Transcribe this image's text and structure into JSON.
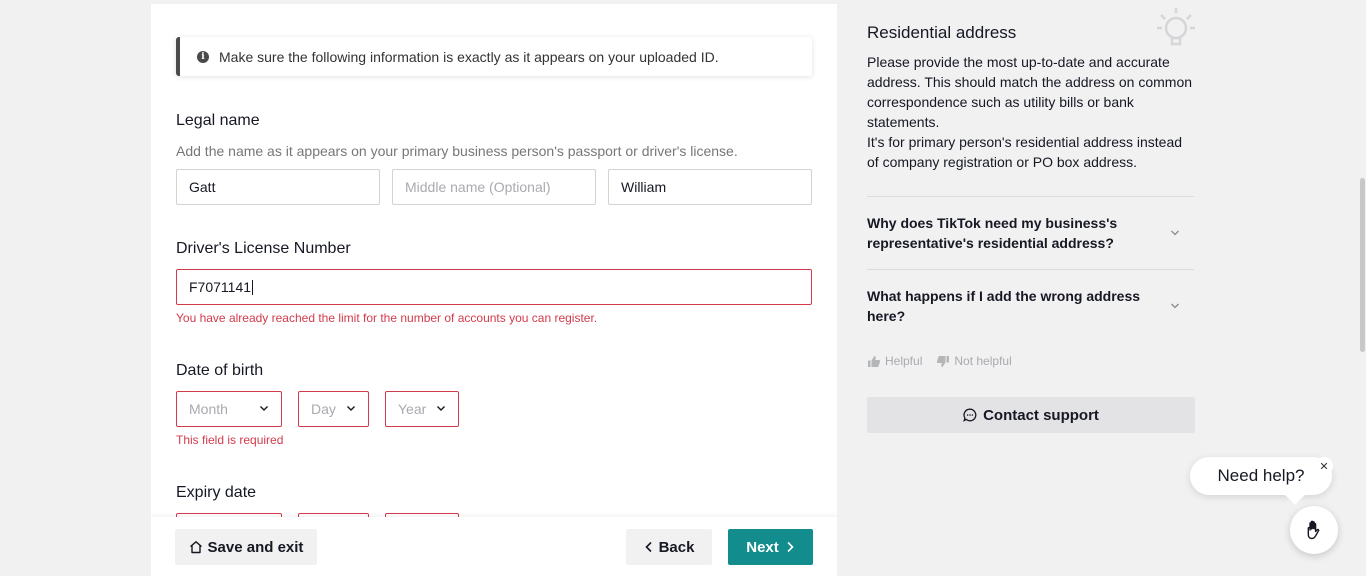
{
  "notice": {
    "text": "Make sure the following information is exactly as it appears on your uploaded ID."
  },
  "legal_name": {
    "label": "Legal name",
    "description": "Add the name as it appears on your primary business person's passport or driver's license.",
    "first_value": "Gatt",
    "middle_placeholder": "Middle name (Optional)",
    "last_value": "William"
  },
  "license": {
    "label": "Driver's License Number",
    "value": "F7071141",
    "error": "You have already reached the limit for the number of accounts you can register."
  },
  "dob": {
    "label": "Date of birth",
    "month_placeholder": "Month",
    "day_placeholder": "Day",
    "year_placeholder": "Year",
    "error": "This field is required"
  },
  "expiry": {
    "label": "Expiry date"
  },
  "footer": {
    "save_label": "Save and exit",
    "back_label": "Back",
    "next_label": "Next"
  },
  "sidebar": {
    "title": "Residential address",
    "paragraph1": "Please provide the most up-to-date and accurate address. This should match the address on common correspondence such as utility bills or bank statements.",
    "paragraph2": "It's for primary person's residential address instead of company registration or PO box address.",
    "faq": [
      {
        "question": "Why does TikTok need my business's representative's residential address?"
      },
      {
        "question": "What happens if I add the wrong address here?"
      }
    ],
    "helpful_label": "Helpful",
    "not_helpful_label": "Not helpful",
    "contact_label": "Contact support"
  },
  "help_widget": {
    "bubble_text": "Need help?",
    "close_glyph": "✕"
  },
  "colors": {
    "primary": "#128c8c",
    "error": "#d23b4c"
  },
  "icons": [
    "info-icon",
    "chevron-down-icon",
    "home-icon",
    "chevron-left-icon",
    "chevron-right-icon",
    "lightbulb-icon",
    "thumbs-up-icon",
    "thumbs-down-icon",
    "chat-icon",
    "hand-icon",
    "close-icon"
  ]
}
